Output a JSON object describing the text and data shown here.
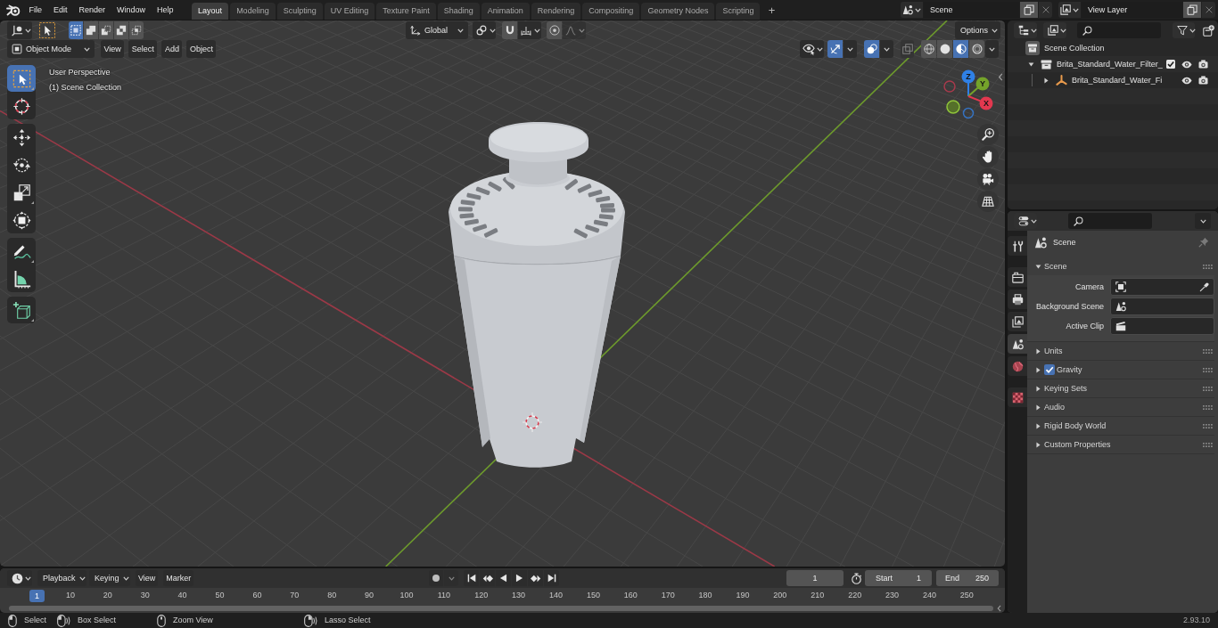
{
  "top_bar": {
    "menus": [
      "File",
      "Edit",
      "Render",
      "Window",
      "Help"
    ],
    "workspaces": [
      {
        "label": "Layout",
        "selected": true
      },
      {
        "label": "Modeling",
        "selected": false
      },
      {
        "label": "Sculpting",
        "selected": false
      },
      {
        "label": "UV Editing",
        "selected": false
      },
      {
        "label": "Texture Paint",
        "selected": false
      },
      {
        "label": "Shading",
        "selected": false
      },
      {
        "label": "Animation",
        "selected": false
      },
      {
        "label": "Rendering",
        "selected": false
      },
      {
        "label": "Compositing",
        "selected": false
      },
      {
        "label": "Geometry Nodes",
        "selected": false
      },
      {
        "label": "Scripting",
        "selected": false
      }
    ],
    "add_workspace": "+",
    "scene": "Scene",
    "view_layer": "View Layer"
  },
  "viewport": {
    "header": {
      "select_modes": [
        {
          "kind": "new",
          "selected": true
        },
        {
          "kind": "extend",
          "selected": false
        },
        {
          "kind": "subtract",
          "selected": false
        },
        {
          "kind": "invert",
          "selected": false
        },
        {
          "kind": "intersect",
          "selected": false
        }
      ],
      "orientation": "Global",
      "snap": {
        "on": false
      },
      "proportional": {
        "on": false
      },
      "options": "Options",
      "mode": "Object Mode",
      "menus": [
        "View",
        "Select",
        "Add",
        "Object"
      ],
      "gizmos": {
        "on": true
      },
      "overlays": {
        "on": true
      },
      "xray": {
        "on": false
      },
      "shading": [
        {
          "kind": "wireframe",
          "selected": false
        },
        {
          "kind": "solid",
          "selected": false
        },
        {
          "kind": "material",
          "selected": true
        },
        {
          "kind": "rendered",
          "selected": false
        }
      ]
    },
    "view_name": "User Perspective",
    "collection": "(1) Scene Collection",
    "tool_groups": [
      {
        "tools": [
          {
            "kind": "select_box",
            "selected": true
          },
          {
            "kind": "cursor",
            "selected": false
          }
        ]
      },
      {
        "tools": [
          {
            "kind": "move",
            "selected": false
          },
          {
            "kind": "rotate",
            "selected": false
          },
          {
            "kind": "scale",
            "selected": false
          },
          {
            "kind": "transform",
            "selected": false
          }
        ]
      },
      {
        "tools": [
          {
            "kind": "annotate",
            "selected": false
          },
          {
            "kind": "measure",
            "selected": false
          }
        ]
      },
      {
        "tools": [
          {
            "kind": "add_cube",
            "selected": false
          }
        ]
      }
    ],
    "gizmo_axes": [
      {
        "kind": "z",
        "label": "Z"
      },
      {
        "kind": "y",
        "label": "Y"
      },
      {
        "kind": "x",
        "label": "X"
      }
    ]
  },
  "outliner": {
    "items": [
      {
        "label": "Scene Collection",
        "kind": "scene_collection",
        "children": [
          {
            "label": "Brita_Standard_Water_Filter_",
            "kind": "collection",
            "expanded": true,
            "checked": true,
            "children": [
              {
                "label": "Brita_Standard_Water_Fi",
                "kind": "object",
                "expanded": false
              }
            ]
          }
        ]
      }
    ]
  },
  "properties": {
    "tab_groups": [
      {
        "tabs": [
          {
            "kind": "tool",
            "selected": false
          }
        ]
      },
      {
        "tabs": [
          {
            "kind": "render",
            "selected": false
          },
          {
            "kind": "output",
            "selected": false
          },
          {
            "kind": "view_layer",
            "selected": false
          },
          {
            "kind": "scene",
            "selected": true
          },
          {
            "kind": "world",
            "selected": false
          }
        ]
      },
      {
        "tabs": [
          {
            "kind": "texture",
            "selected": false
          }
        ]
      }
    ],
    "context": "Scene",
    "panels": [
      {
        "label": "Scene",
        "expanded": true,
        "fields": [
          {
            "label": "Camera",
            "kind": "camera"
          },
          {
            "label": "Background Scene",
            "kind": "scene"
          },
          {
            "label": "Active Clip",
            "kind": "clip"
          }
        ]
      },
      {
        "label": "Units",
        "expanded": false
      },
      {
        "label": "Gravity",
        "expanded": false,
        "checked": true
      },
      {
        "label": "Keying Sets",
        "expanded": false
      },
      {
        "label": "Audio",
        "expanded": false
      },
      {
        "label": "Rigid Body World",
        "expanded": false
      },
      {
        "label": "Custom Properties",
        "expanded": false
      }
    ]
  },
  "timeline": {
    "menus": [
      {
        "label": "Playback",
        "kind": "dropdown"
      },
      {
        "label": "Keying",
        "kind": "dropdown"
      },
      {
        "label": "View",
        "kind": "menu"
      },
      {
        "label": "Marker",
        "kind": "menu"
      }
    ],
    "auto_keying": {
      "on": false
    },
    "current_frame": "1",
    "start": {
      "label": "Start",
      "value": "1"
    },
    "end": {
      "label": "End",
      "value": "250"
    },
    "playhead": "1",
    "ruler": [
      "10",
      "20",
      "30",
      "40",
      "50",
      "60",
      "70",
      "80",
      "90",
      "100",
      "110",
      "120",
      "130",
      "140",
      "150",
      "160",
      "170",
      "180",
      "190",
      "200",
      "210",
      "220",
      "230",
      "240",
      "250"
    ]
  },
  "status_bar": {
    "hints": [
      {
        "kind": "left_click",
        "label": "Select"
      },
      {
        "kind": "left_drag",
        "label": "Box Select"
      },
      {
        "kind": "middle_drag",
        "label": "Zoom View"
      },
      {
        "kind": "right_drag",
        "label": "Lasso Select"
      }
    ],
    "version": "2.93.10"
  }
}
